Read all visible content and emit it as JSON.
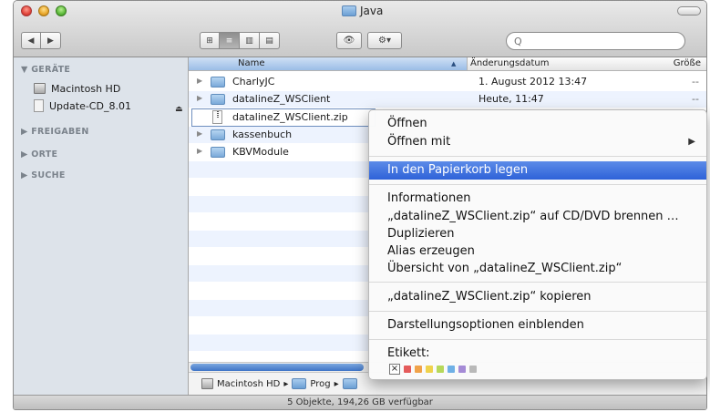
{
  "window": {
    "title": "Java"
  },
  "toolbar": {
    "back_label": "◀",
    "forward_label": "▶",
    "view_icons": "⊞",
    "view_list": "≡",
    "view_columns": "▥",
    "view_coverflow": "▤",
    "quicklook": "👁",
    "action": "⚙▾",
    "search_placeholder": "Q"
  },
  "sidebar": {
    "sections": {
      "devices": "▼ GERÄTE",
      "shared": "▶ FREIGABEN",
      "places": "▶ ORTE",
      "search": "▶ SUCHE"
    },
    "devices": [
      {
        "label": "Macintosh HD",
        "icon": "hard-disk-icon"
      },
      {
        "label": "Update-CD_8.01",
        "icon": "cd-icon"
      }
    ],
    "eject": "⏏"
  },
  "list": {
    "columns": {
      "name": "Name",
      "date": "Änderungsdatum",
      "size": "Größe"
    },
    "rows": [
      {
        "name": "CharlyJC",
        "date": "1. August 2012 13:47",
        "size": "--",
        "type": "folder"
      },
      {
        "name": "datalineZ_WSClient",
        "date": "Heute, 11:47",
        "size": "--",
        "type": "folder"
      },
      {
        "name": "datalineZ_WSClient.zip",
        "date": "",
        "size": "",
        "type": "zip"
      },
      {
        "name": "kassenbuch",
        "date": "",
        "size": "",
        "type": "folder"
      },
      {
        "name": "KBVModule",
        "date": "",
        "size": "",
        "type": "folder"
      }
    ]
  },
  "pathbar": {
    "items": [
      "Macintosh HD",
      "▸",
      "Prog",
      "▸"
    ]
  },
  "status": {
    "text": "5 Objekte, 194,26 GB verfügbar"
  },
  "context_menu": {
    "open": "Öffnen",
    "open_with": "Öffnen mit",
    "trash": "In den Papierkorb legen",
    "info": "Informationen",
    "burn": "„datalineZ_WSClient.zip“ auf CD/DVD brennen …",
    "duplicate": "Duplizieren",
    "alias": "Alias erzeugen",
    "overview": "Übersicht von „datalineZ_WSClient.zip“",
    "copy": "„datalineZ_WSClient.zip“ kopieren",
    "view_options": "Darstellungsoptionen einblenden",
    "label_title": "Etikett:",
    "label_none": "×",
    "label_colors": [
      "#e45b5b",
      "#f0a24a",
      "#efd24c",
      "#b6d85a",
      "#6fb0e6",
      "#a58bd6",
      "#b9b9b9"
    ]
  }
}
